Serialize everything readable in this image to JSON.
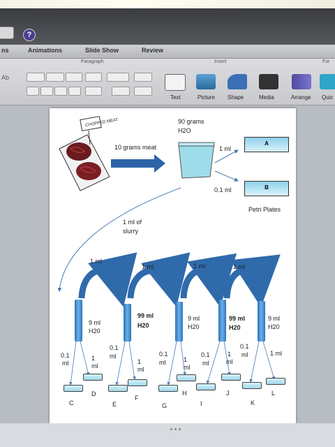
{
  "tabs": [
    "ns",
    "Animations",
    "Slide Show",
    "Review"
  ],
  "ribbon": {
    "groups": {
      "paragraph": "Paragraph",
      "insert": "Insert",
      "format": "For"
    },
    "buttons": [
      "Text",
      "Picture",
      "Shape",
      "Media",
      "Arrange",
      "Quic"
    ],
    "styles_label": "Ab"
  },
  "slide": {
    "meat_label": "CHOPPED MEAT",
    "water": "90 grams",
    "water2": "H2O",
    "meat_amount": "10 grams meat",
    "ml_1": "1 ml",
    "ml_01": "0.1 ml",
    "plate_a": "A",
    "plate_b": "B",
    "petri": "Petri Plates",
    "slurry1": "1 ml of",
    "slurry2": "slurry",
    "transfer": "1 ml",
    "tubes": [
      {
        "v1": "9 ml",
        "v2": "H20",
        "bold": false
      },
      {
        "v1": "99 ml",
        "v2": "H20",
        "bold": true
      },
      {
        "v1": "9 ml",
        "v2": "H20",
        "bold": false
      },
      {
        "v1": "99 ml",
        "v2": "H20",
        "bold": true
      },
      {
        "v1": "9 ml",
        "v2": "H20",
        "bold": false
      }
    ],
    "dish_labels": [
      "C",
      "D",
      "E",
      "F",
      "G",
      "H",
      "I",
      "J",
      "K",
      "L"
    ],
    "split_small": "0.1",
    "split_small_unit": "ml",
    "split_big": "1",
    "split_big_unit": "ml",
    "last_right": "1 ml"
  }
}
